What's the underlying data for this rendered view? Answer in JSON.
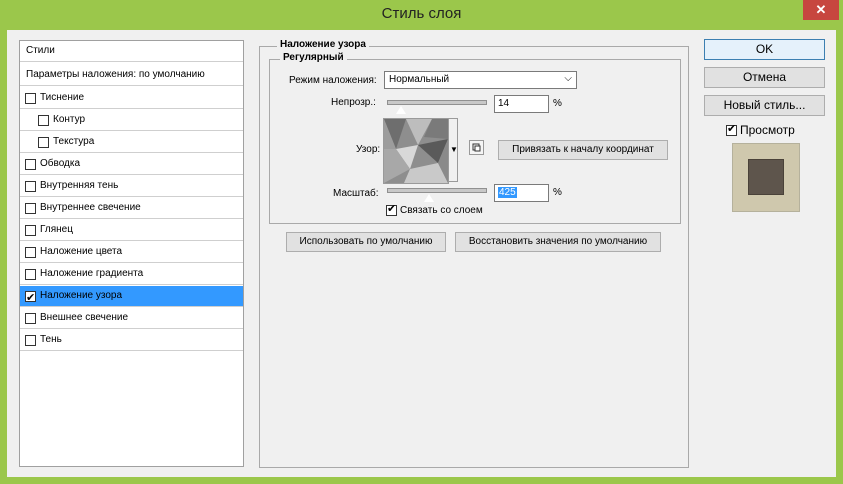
{
  "window": {
    "title": "Стиль слоя",
    "close": "✕"
  },
  "left_panel": {
    "header": "Стили",
    "blend_defaults": "Параметры наложения: по умолчанию",
    "items": [
      {
        "label": "Тиснение",
        "checked": false
      },
      {
        "label": "Контур",
        "checked": false
      },
      {
        "label": "Текстура",
        "checked": false
      },
      {
        "label": "Обводка",
        "checked": false
      },
      {
        "label": "Внутренняя тень",
        "checked": false
      },
      {
        "label": "Внутреннее свечение",
        "checked": false
      },
      {
        "label": "Глянец",
        "checked": false
      },
      {
        "label": "Наложение цвета",
        "checked": false
      },
      {
        "label": "Наложение градиента",
        "checked": false
      },
      {
        "label": "Наложение узора",
        "checked": true
      },
      {
        "label": "Внешнее свечение",
        "checked": false
      },
      {
        "label": "Тень",
        "checked": false
      }
    ]
  },
  "pattern_overlay": {
    "group_title": "Наложение узора",
    "subgroup_title": "Регулярный",
    "blend_mode_label": "Режим наложения:",
    "blend_mode_value": "Нормальный",
    "opacity_label": "Непрозр.:",
    "opacity_value": "14",
    "opacity_unit": "%",
    "opacity_level": 14,
    "pattern_label": "Узор:",
    "snap_button": "Привязать к началу координат",
    "scale_label": "Масштаб:",
    "scale_value": "425",
    "scale_unit": "%",
    "scale_level": 425,
    "link_label": "Связать со слоем",
    "link_checked": true,
    "default_button": "Использовать по умолчанию",
    "reset_button": "Восстановить значения по умолчанию"
  },
  "actions": {
    "ok": "OK",
    "cancel": "Отмена",
    "new_style": "Новый стиль...",
    "preview_label": "Просмотр",
    "preview_checked": true
  },
  "colors": {
    "frame": "#9bc74b",
    "selected": "#3399ff",
    "preview_bg": "#cfc8ad",
    "preview_square": "#5e554c"
  }
}
